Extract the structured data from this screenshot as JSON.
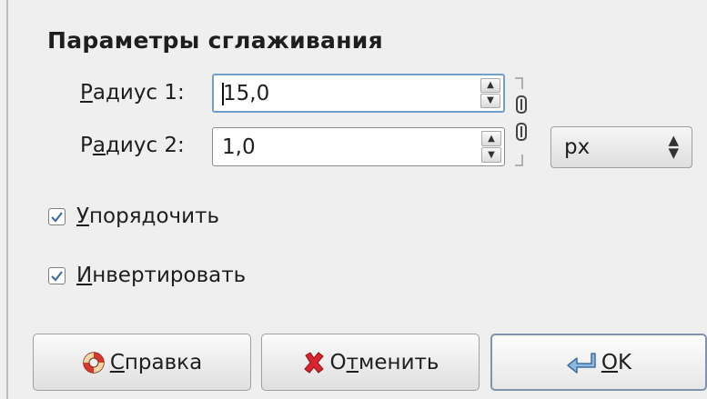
{
  "window": {
    "group_title": "Параметры сглаживания"
  },
  "radius1": {
    "label_prefix": "",
    "label_mnemonic": "Р",
    "label_rest": "адиус 1:",
    "value": "15,0"
  },
  "radius2": {
    "label_prefix": "Р",
    "label_mnemonic": "а",
    "label_rest": "диус 2:",
    "value": "1,0"
  },
  "units": {
    "selected": "px",
    "arrows_up": "▲",
    "arrows_down": "▼"
  },
  "spinner": {
    "up": "▲",
    "down": "▼"
  },
  "chain": {
    "icon": "chain-link-icon",
    "linked": true
  },
  "checkboxes": {
    "order": {
      "mnemonic": "У",
      "rest": "порядочить",
      "checked": true
    },
    "invert": {
      "mnemonic": "И",
      "rest": "нвертировать",
      "checked": true
    }
  },
  "buttons": {
    "help": {
      "mnemonic": "С",
      "rest": "правка",
      "icon": "lifebuoy-icon"
    },
    "cancel": {
      "prefix": "О",
      "mnemonic": "т",
      "rest": "менить",
      "icon": "cancel-x-icon"
    },
    "ok": {
      "mnemonic": "O",
      "rest": "K",
      "icon": "return-arrow-icon"
    }
  },
  "colors": {
    "focus_border": "#6f9fcf",
    "check_mark": "#3a6ea5",
    "cancel_icon": "#d9252b",
    "help_icon_red": "#d9362c",
    "ok_arrow": "#4a86c8"
  }
}
